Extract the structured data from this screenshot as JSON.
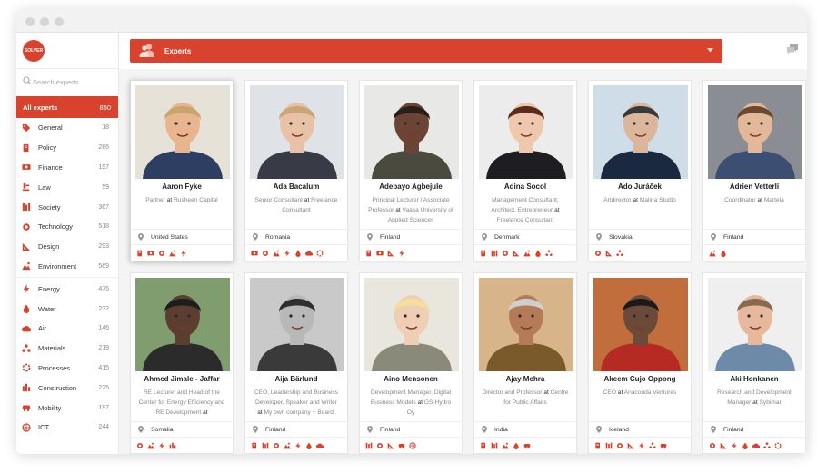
{
  "sidebar": {
    "logo_text": "SOLVER",
    "search_placeholder": "Search experts",
    "all_label": "All experts",
    "all_count": "850",
    "groups": [
      [
        {
          "label": "General",
          "count": "18",
          "icon": "tag-icon"
        },
        {
          "label": "Policy",
          "count": "286",
          "icon": "policy-icon"
        },
        {
          "label": "Finance",
          "count": "197",
          "icon": "finance-icon"
        },
        {
          "label": "Law",
          "count": "59",
          "icon": "law-icon"
        },
        {
          "label": "Society",
          "count": "367",
          "icon": "society-icon"
        },
        {
          "label": "Technology",
          "count": "518",
          "icon": "technology-icon"
        },
        {
          "label": "Design",
          "count": "293",
          "icon": "design-icon"
        },
        {
          "label": "Environment",
          "count": "569",
          "icon": "environment-icon"
        }
      ],
      [
        {
          "label": "Energy",
          "count": "475",
          "icon": "energy-icon"
        },
        {
          "label": "Water",
          "count": "232",
          "icon": "water-icon"
        },
        {
          "label": "Air",
          "count": "146",
          "icon": "air-icon"
        },
        {
          "label": "Materials",
          "count": "219",
          "icon": "materials-icon"
        },
        {
          "label": "Processes",
          "count": "415",
          "icon": "processes-icon"
        },
        {
          "label": "Construction",
          "count": "225",
          "icon": "construction-icon"
        },
        {
          "label": "Mobility",
          "count": "197",
          "icon": "mobility-icon"
        },
        {
          "label": "ICT",
          "count": "244",
          "icon": "ict-icon"
        }
      ]
    ]
  },
  "header": {
    "title": "Experts"
  },
  "colors": {
    "accent": "#d9432e",
    "muted": "#888888",
    "background": "#f4f4f4"
  },
  "experts": [
    {
      "name": "Aaron Fyke",
      "role": "Partner",
      "org": "Rusheen Capital",
      "location": "United States",
      "tags": [
        "policy-icon",
        "finance-icon",
        "technology-icon",
        "environment-icon",
        "energy-icon"
      ]
    },
    {
      "name": "Ada Bacalum",
      "role": "Senior Consultant",
      "org": "Freelance Consultant",
      "location": "Romania",
      "tags": [
        "finance-icon",
        "technology-icon",
        "environment-icon",
        "energy-icon",
        "water-icon",
        "air-icon",
        "processes-icon"
      ]
    },
    {
      "name": "Adebayo Agbejule",
      "role": "Principal Lecturer / Associate Professor",
      "org": "Vaasa University of Applied Sciences",
      "location": "Finland",
      "tags": [
        "policy-icon",
        "finance-icon",
        "design-icon",
        "energy-icon"
      ]
    },
    {
      "name": "Adina Socol",
      "role": "Management Consultant, Architect, Entrepreneur",
      "org": "Freelance Consultant",
      "location": "Denmark",
      "tags": [
        "policy-icon",
        "society-icon",
        "technology-icon",
        "design-icon",
        "environment-icon",
        "water-icon",
        "materials-icon"
      ]
    },
    {
      "name": "Ado Juráček",
      "role": "Artdirector",
      "org": "Malina Studio",
      "location": "Slovakia",
      "tags": [
        "technology-icon",
        "design-icon",
        "materials-icon"
      ]
    },
    {
      "name": "Adrien Vetterli",
      "role": "Coordinator",
      "org": "Martela",
      "location": "Finland",
      "tags": [
        "environment-icon",
        "water-icon"
      ]
    },
    {
      "name": "Ahmed Jimale - Jaffar",
      "role": "RE Lecturer and Head of the Center for Energy Efficiency and RE Development",
      "org": "",
      "location": "Somalia",
      "tags": [
        "technology-icon",
        "environment-icon",
        "energy-icon",
        "construction-icon"
      ]
    },
    {
      "name": "Aija Bärlund",
      "role": "CEO, Leadership and Business Developer, Speaker and Writer",
      "org": "My own company + Board,",
      "location": "Finland",
      "tags": [
        "policy-icon",
        "society-icon",
        "technology-icon",
        "environment-icon",
        "energy-icon",
        "water-icon",
        "air-icon"
      ]
    },
    {
      "name": "Aino Mensonen",
      "role": "Development Manager, Digital Business Models",
      "org": "GS-Hydro Oy",
      "location": "Finland",
      "tags": [
        "society-icon",
        "technology-icon",
        "design-icon",
        "mobility-icon",
        "ict-icon"
      ]
    },
    {
      "name": "Ajay Mehra",
      "role": "Director and Professor",
      "org": "Centre for Public Affairs",
      "location": "India",
      "tags": [
        "policy-icon",
        "society-icon",
        "environment-icon",
        "water-icon",
        "mobility-icon"
      ]
    },
    {
      "name": "Akeem Cujo Oppong",
      "role": "CEO",
      "org": "Anaconda Ventures",
      "location": "Iceland",
      "tags": [
        "policy-icon",
        "society-icon",
        "technology-icon",
        "design-icon",
        "energy-icon",
        "materials-icon",
        "mobility-icon"
      ]
    },
    {
      "name": "Aki Honkanen",
      "role": "Research and Development Manager",
      "org": "Sybimar",
      "location": "Finland",
      "tags": [
        "technology-icon",
        "design-icon",
        "energy-icon",
        "water-icon",
        "air-icon",
        "materials-icon",
        "processes-icon"
      ]
    }
  ]
}
